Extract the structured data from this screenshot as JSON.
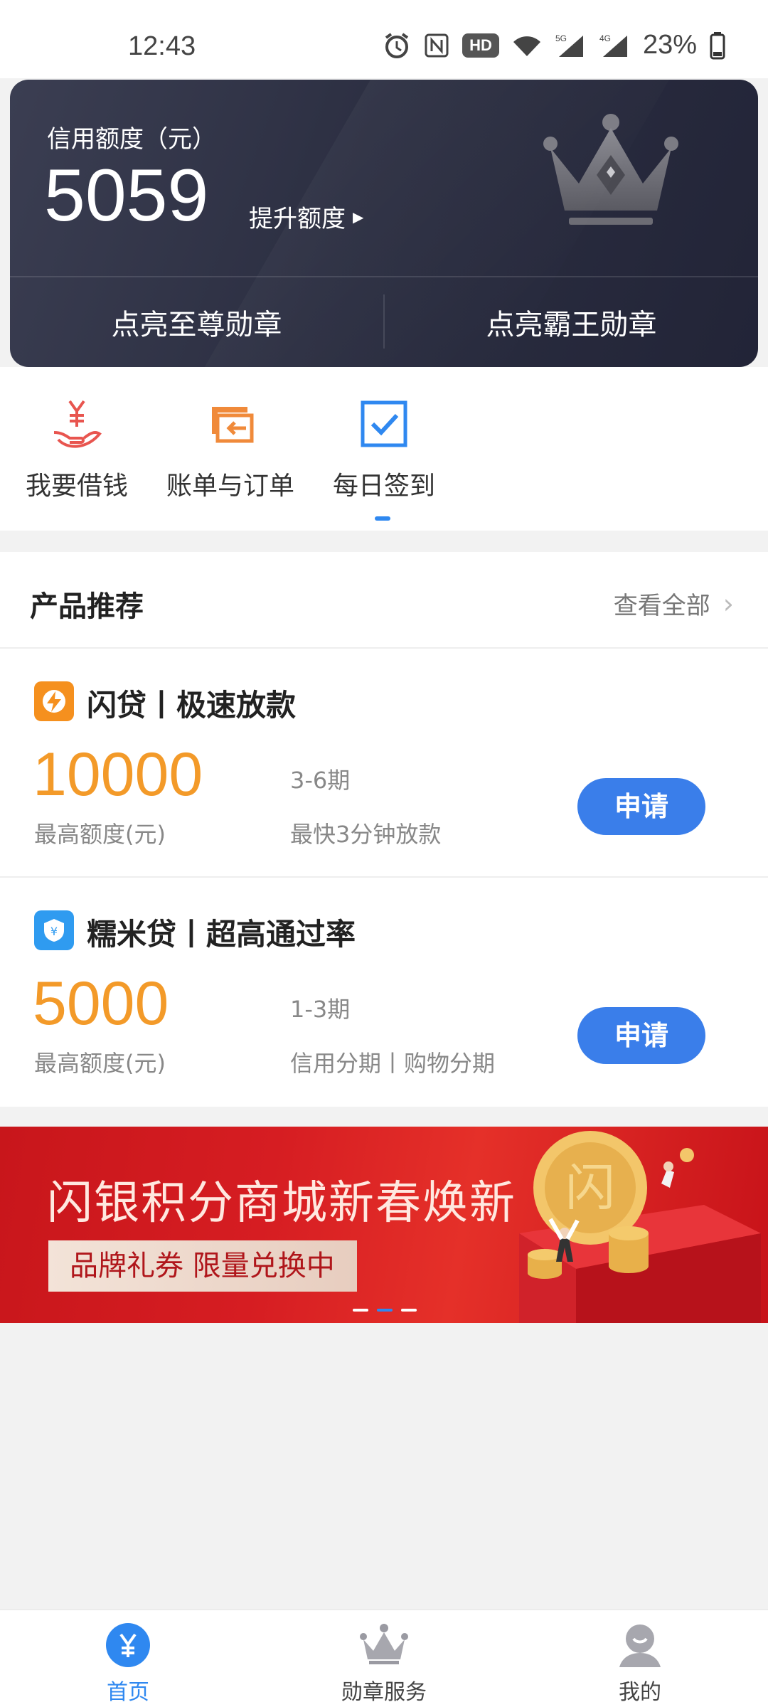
{
  "status_bar": {
    "time": "12:43",
    "hd_label": "HD",
    "battery_percent": "23%",
    "net1": "5G",
    "net2": "4G"
  },
  "credit_card": {
    "label": "信用额度（元）",
    "amount": "5059",
    "raise_label": "提升额度",
    "badge_left": "点亮至尊勋章",
    "badge_right": "点亮霸王勋章"
  },
  "quick_menu": {
    "items": [
      {
        "label": "我要借钱",
        "icon": "yuan-hand-icon"
      },
      {
        "label": "账单与订单",
        "icon": "bill-transfer-icon"
      },
      {
        "label": "每日签到",
        "icon": "checkin-check-icon"
      }
    ],
    "selected_index": 2
  },
  "products": {
    "title": "产品推荐",
    "view_all": "查看全部",
    "items": [
      {
        "name": "闪贷丨极速放款",
        "amount": "10000",
        "amount_label": "最高额度(元)",
        "period": "3-6期",
        "desc": "最快3分钟放款",
        "apply_label": "申请",
        "logo_color": "#f5901e"
      },
      {
        "name": "糯米贷丨超高通过率",
        "amount": "5000",
        "amount_label": "最高额度(元)",
        "period": "1-3期",
        "desc": "信用分期丨购物分期",
        "apply_label": "申请",
        "logo_color": "#2f9bf0"
      }
    ]
  },
  "banner": {
    "title": "闪银积分商城新春焕新",
    "subtitle": "品牌礼券 限量兑换中",
    "coin_text": "闪",
    "active_dot": 1,
    "dot_count": 3
  },
  "bottom_nav": {
    "items": [
      {
        "label": "首页",
        "icon": "home-yuan-icon",
        "active": true
      },
      {
        "label": "勋章服务",
        "icon": "crown-icon",
        "active": false
      },
      {
        "label": "我的",
        "icon": "profile-icon",
        "active": false
      }
    ]
  },
  "colors": {
    "accent_blue": "#3a7eea",
    "amount_orange": "#f39a29",
    "card_dark": "#2c2f42"
  }
}
